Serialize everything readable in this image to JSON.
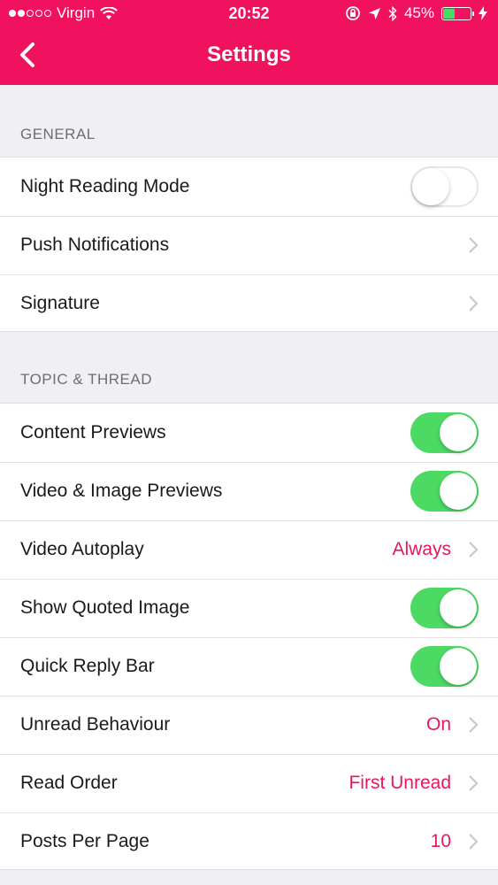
{
  "status_bar": {
    "carrier": "Virgin",
    "time": "20:52",
    "battery": "45%",
    "battery_level": 0.45
  },
  "nav": {
    "title": "Settings",
    "back_icon": "chevron-left-icon"
  },
  "colors": {
    "accent": "#f0115f",
    "toggle_on": "#4cd964",
    "value_text": "#e8165f"
  },
  "sections": {
    "general": {
      "header": "GENERAL",
      "night_reading_mode": {
        "label": "Night Reading Mode",
        "on": false
      },
      "push_notifications": {
        "label": "Push Notifications"
      },
      "signature": {
        "label": "Signature"
      }
    },
    "topic_thread": {
      "header": "TOPIC & THREAD",
      "content_previews": {
        "label": "Content Previews",
        "on": true
      },
      "video_image_previews": {
        "label": "Video & Image Previews",
        "on": true
      },
      "video_autoplay": {
        "label": "Video Autoplay",
        "value": "Always"
      },
      "show_quoted_image": {
        "label": "Show Quoted Image",
        "on": true
      },
      "quick_reply_bar": {
        "label": "Quick Reply Bar",
        "on": true
      },
      "unread_behaviour": {
        "label": "Unread Behaviour",
        "value": "On"
      },
      "read_order": {
        "label": "Read Order",
        "value": "First Unread"
      },
      "posts_per_page": {
        "label": "Posts Per Page",
        "value": "10"
      }
    }
  }
}
